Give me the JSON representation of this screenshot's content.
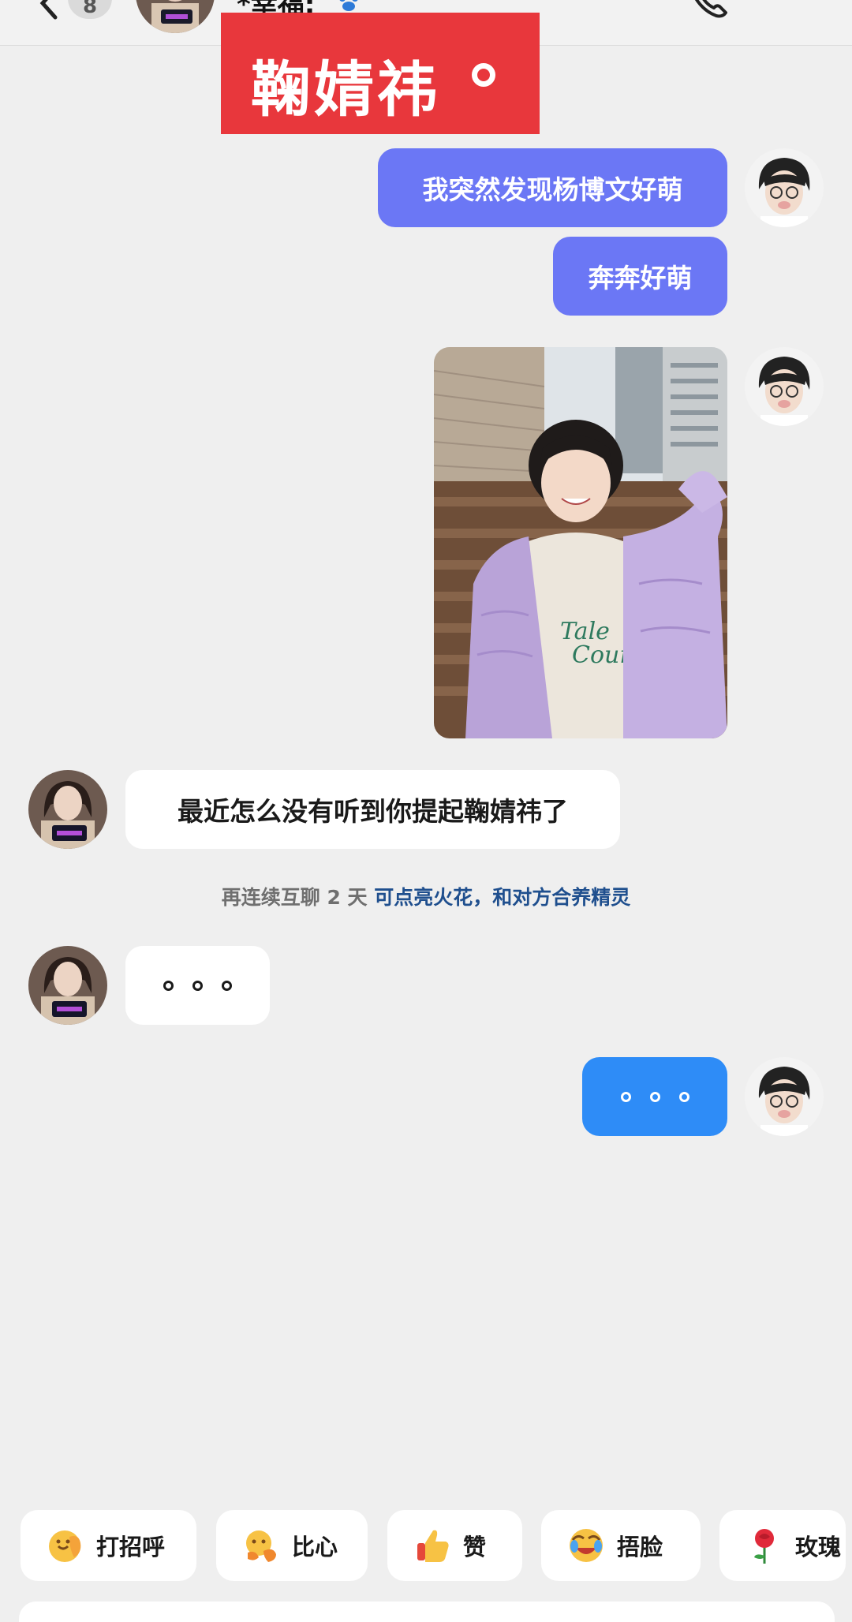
{
  "header": {
    "unread_count": "8",
    "contact_name": "*幸福:"
  },
  "overlay": {
    "title": "鞠婧祎"
  },
  "messages": {
    "m1": "我突然发现杨博文好萌",
    "m2": "奔奔好萌",
    "m4": "最近怎么没有听到你提起鞠婧祎了"
  },
  "system_tip": {
    "prefix": "再连续互聊 2 天 ",
    "link": "可点亮火花，和对方合养精灵"
  },
  "quick_replies": [
    {
      "label": "打招呼",
      "icon": "waving-hand-emoji"
    },
    {
      "label": "比心",
      "icon": "heart-hands-emoji"
    },
    {
      "label": "赞",
      "icon": "thumbs-up-emoji"
    },
    {
      "label": "捂脸",
      "icon": "facepalm-laughing-emoji"
    },
    {
      "label": "玫瑰",
      "icon": "rose-emoji"
    }
  ],
  "colors": {
    "background": "#efefef",
    "bubble_purple": "#6b77f5",
    "bubble_blue": "#2e8cf7",
    "bubble_white": "#ffffff",
    "overlay_red": "#e8373c",
    "tip_link": "#1f4f8e"
  }
}
